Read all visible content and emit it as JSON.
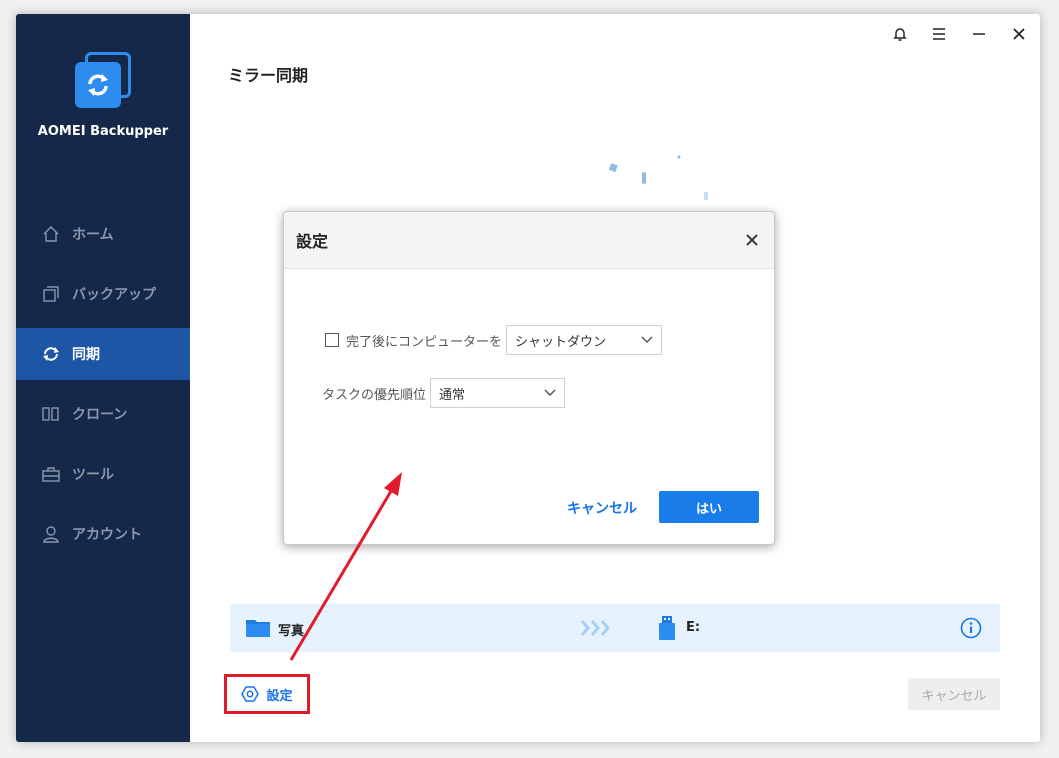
{
  "app": {
    "name": "AOMEI Backupper"
  },
  "sidebar": {
    "items": [
      {
        "label": "ホーム",
        "icon": "home-icon"
      },
      {
        "label": "バックアップ",
        "icon": "backup-icon"
      },
      {
        "label": "同期",
        "icon": "sync-icon",
        "active": true
      },
      {
        "label": "クローン",
        "icon": "clone-icon"
      },
      {
        "label": "ツール",
        "icon": "tools-icon"
      },
      {
        "label": "アカウント",
        "icon": "account-icon"
      }
    ]
  },
  "page": {
    "title": "ミラー同期"
  },
  "sync": {
    "source": "写真",
    "destination": "E:"
  },
  "footer": {
    "settings_label": "設定",
    "cancel_label": "キャンセル"
  },
  "dialog": {
    "title": "設定",
    "after_complete_label": "完了後にコンピューターを",
    "after_complete_value": "シャットダウン",
    "priority_label": "タスクの優先順位",
    "priority_value": "通常",
    "cancel_label": "キャンセル",
    "ok_label": "はい"
  },
  "colors": {
    "accent": "#1a7ce8",
    "sidebar": "#16284a",
    "highlight": "#e11b2b"
  }
}
